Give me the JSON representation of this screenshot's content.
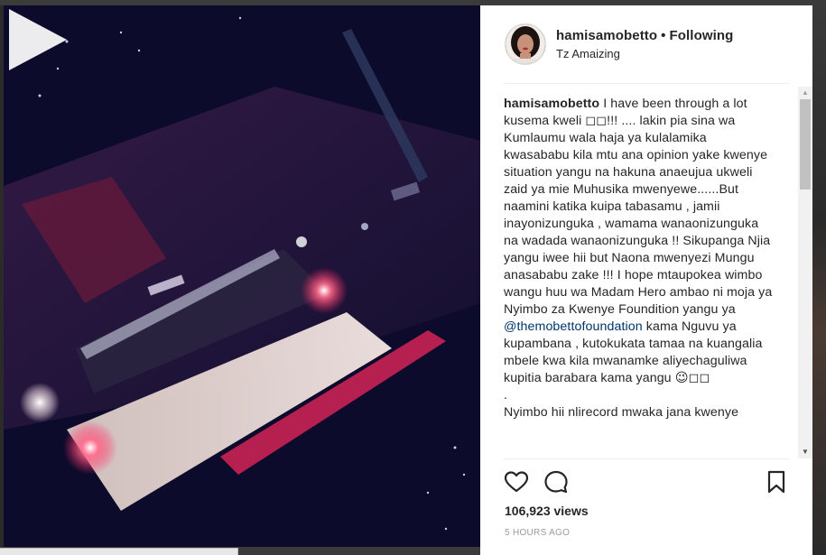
{
  "post": {
    "username": "hamisamobetto",
    "separator": "•",
    "follow_state": "Following",
    "location": "Tz Amaizing",
    "caption_user": "hamisamobetto",
    "caption_part1": " I have been through a lot kusema kweli ◻◻!!! .... lakin pia sina wa Kumlaumu wala haja ya kulalamika kwasababu kila mtu ana opinion yake kwenye situation yangu na hakuna anaeujua ukweli zaid ya mie Muhusika mwenyewe......But naamini katika kuipa tabasamu , jamii inayonizunguka , wamama wanaonizunguka na wadada wanaonizunguka !! Sikupanga Njia yangu iwee hii but Naona mwenyezi Mungu anasababu zake !!! I hope mtaupokea wimbo wangu huu wa Madam Hero ambao ni moja ya Nyimbo za Kwenye Foundition yangu ya ",
    "caption_mention": "@themobettofoundation",
    "caption_part2": " kama Nguvu ya kupambana , kutokukata tamaa na kuangalia mbele kwa kila mwanamke aliyechaguliwa kupitia barabara kama yangu 😉◻◻",
    "caption_dot": ".",
    "caption_part3": "Nyimbo hii nlirecord mwaka jana kwenye",
    "views": "106,923 views",
    "timestamp": "5 HOURS AGO"
  },
  "icons": {
    "like": "heart-icon",
    "comment": "comment-icon",
    "save": "bookmark-icon",
    "play": "play-icon"
  },
  "colors": {
    "text": "#262626",
    "mention": "#003569",
    "muted": "#999999",
    "divider": "#efefef",
    "media_bg": "#0b0a26"
  }
}
